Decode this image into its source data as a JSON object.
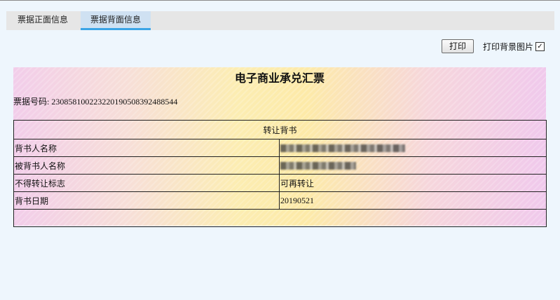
{
  "tabs": [
    {
      "label": "票据正面信息",
      "active": false
    },
    {
      "label": "票据背面信息",
      "active": true
    }
  ],
  "toolbar": {
    "print_label": "打印",
    "print_background_label": "打印背景图片",
    "print_background_checked": true,
    "check_mark": "☑"
  },
  "bill": {
    "title": "电子商业承兑汇票",
    "number_label": "票据号码:",
    "number_value": "230858100223220190508392488544",
    "endorsement": {
      "header": "转让背书",
      "rows": [
        {
          "label": "背书人名称",
          "value": "",
          "redacted": true
        },
        {
          "label": "被背书人名称",
          "value": "",
          "redacted": true
        },
        {
          "label": "不得转让标志",
          "value": "可再转让"
        },
        {
          "label": "背书日期",
          "value": "20190521"
        }
      ]
    }
  }
}
